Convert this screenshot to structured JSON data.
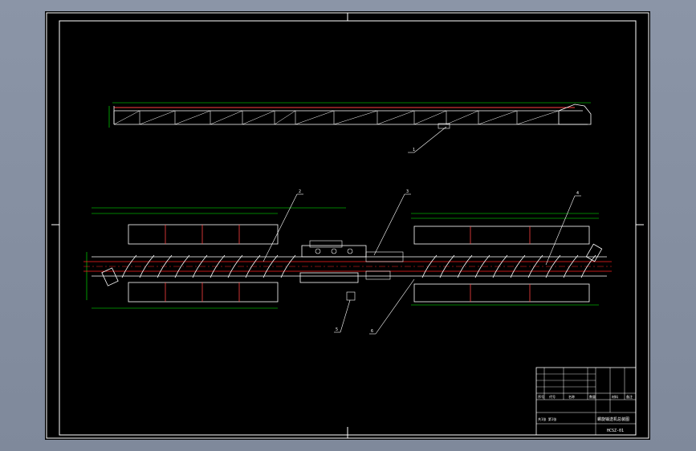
{
  "viewer": {
    "background": "#8a94a6",
    "sheet_color": "#000000"
  },
  "colors": {
    "frame": "#ffffff",
    "dimension": "#00ff00",
    "centerline": "#ff2020",
    "structure": "#ffffff",
    "accent": "#ff4040"
  },
  "drawing": {
    "callouts": [
      "1",
      "2",
      "3",
      "4",
      "5",
      "6"
    ],
    "title_block": {
      "drawing_number": "HCSZ-01",
      "title": "螺旋输送机总装图",
      "headers": [
        "序号",
        "代号",
        "名称",
        "数量",
        "材料",
        "备注"
      ],
      "sheet": "共1张 第1张"
    }
  }
}
